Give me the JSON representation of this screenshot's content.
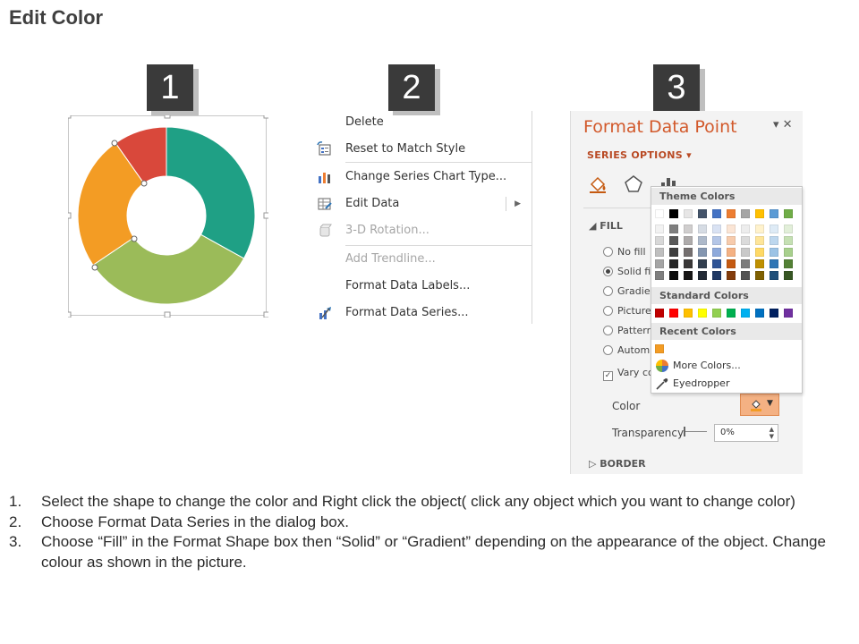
{
  "page": {
    "title": "Edit Color"
  },
  "steps": [
    "1",
    "2",
    "3"
  ],
  "donut": {
    "segments": [
      {
        "color": "#1fa085",
        "label": "teal"
      },
      {
        "color": "#9bbb59",
        "label": "green"
      },
      {
        "color": "#f39c24",
        "label": "orange"
      },
      {
        "color": "#d9483b",
        "label": "red"
      }
    ]
  },
  "context_menu": {
    "items": [
      {
        "label": "Delete",
        "disabled": false,
        "icon": "none"
      },
      {
        "label": "Reset to Match Style",
        "disabled": false,
        "icon": "reset-style-icon"
      },
      {
        "label": "Change Series Chart Type...",
        "disabled": false,
        "icon": "chart-type-icon"
      },
      {
        "label": "Edit Data",
        "disabled": false,
        "icon": "edit-data-icon",
        "submenu": true
      },
      {
        "label": "3-D Rotation...",
        "disabled": true,
        "icon": "rotation-3d-icon"
      },
      {
        "label": "Add Trendline...",
        "disabled": true,
        "icon": "none"
      },
      {
        "label": "Format Data Labels...",
        "disabled": false,
        "icon": "none"
      },
      {
        "label": "Format Data Series...",
        "disabled": false,
        "icon": "format-series-icon"
      }
    ]
  },
  "format_pane": {
    "title": "Format Data Point",
    "controls": "▾ ✕",
    "series_options": "SERIES OPTIONS ▾",
    "fill_section": "FILL",
    "fill_options": [
      {
        "label": "No fill",
        "selected": false
      },
      {
        "label": "Solid fi",
        "selected": true
      },
      {
        "label": "Gradier",
        "selected": false
      },
      {
        "label": "Picture",
        "selected": false
      },
      {
        "label": "Pattern",
        "selected": false
      },
      {
        "label": "Autom",
        "selected": false
      }
    ],
    "vary_colors": "Vary co",
    "color_label": "Color",
    "transparency_label": "Transparency",
    "transparency_value": "0%",
    "border_section": "BORDER",
    "current_color": "#f39c24"
  },
  "palette": {
    "theme_header": "Theme Colors",
    "standard_header": "Standard Colors",
    "recent_header": "Recent Colors",
    "theme_top": [
      "#ffffff",
      "#000000",
      "#e7e6e6",
      "#44546a",
      "#4472c4",
      "#ed7d31",
      "#a5a5a5",
      "#ffc000",
      "#5b9bd5",
      "#70ad47"
    ],
    "theme_shades": [
      [
        "#f2f2f2",
        "#7f7f7f",
        "#d0cece",
        "#d6dce4",
        "#d9e2f3",
        "#fbe5d5",
        "#ededed",
        "#fff2cc",
        "#deebf6",
        "#e2efd9"
      ],
      [
        "#d8d8d8",
        "#595959",
        "#aeabab",
        "#adb9ca",
        "#b4c6e7",
        "#f7cbac",
        "#dbdbdb",
        "#fee599",
        "#bdd7ee",
        "#c5e0b3"
      ],
      [
        "#bfbfbf",
        "#3f3f3f",
        "#757070",
        "#8496b0",
        "#8eaadb",
        "#f4b183",
        "#c9c9c9",
        "#ffd965",
        "#9cc3e5",
        "#a8d08d"
      ],
      [
        "#a5a5a5",
        "#262626",
        "#3a3838",
        "#323f4f",
        "#2f5496",
        "#c55a11",
        "#7b7b7b",
        "#bf9000",
        "#2e75b5",
        "#538135"
      ],
      [
        "#7f7f7f",
        "#0c0c0c",
        "#171616",
        "#222a35",
        "#1f3864",
        "#833c0b",
        "#525252",
        "#7f6000",
        "#1e4e79",
        "#375623"
      ]
    ],
    "standard": [
      "#c00000",
      "#ff0000",
      "#ffc000",
      "#ffff00",
      "#92d050",
      "#00b050",
      "#00b0f0",
      "#0070c0",
      "#002060",
      "#7030a0"
    ],
    "recent": [
      "#f39c24"
    ],
    "more_colors": "More Colors...",
    "eyedropper": "Eyedropper"
  },
  "instructions": [
    {
      "num": "1.",
      "text": "Select the shape to change the color and Right click the object( click any object which you want to change color)"
    },
    {
      "num": "2.",
      "text": "Choose Format Data Series in the dialog box."
    },
    {
      "num": "3.",
      "text": "Choose “Fill” in the Format Shape box then “Solid” or “Gradient” depending on the appearance of the object. Change colour as shown in the picture."
    }
  ]
}
